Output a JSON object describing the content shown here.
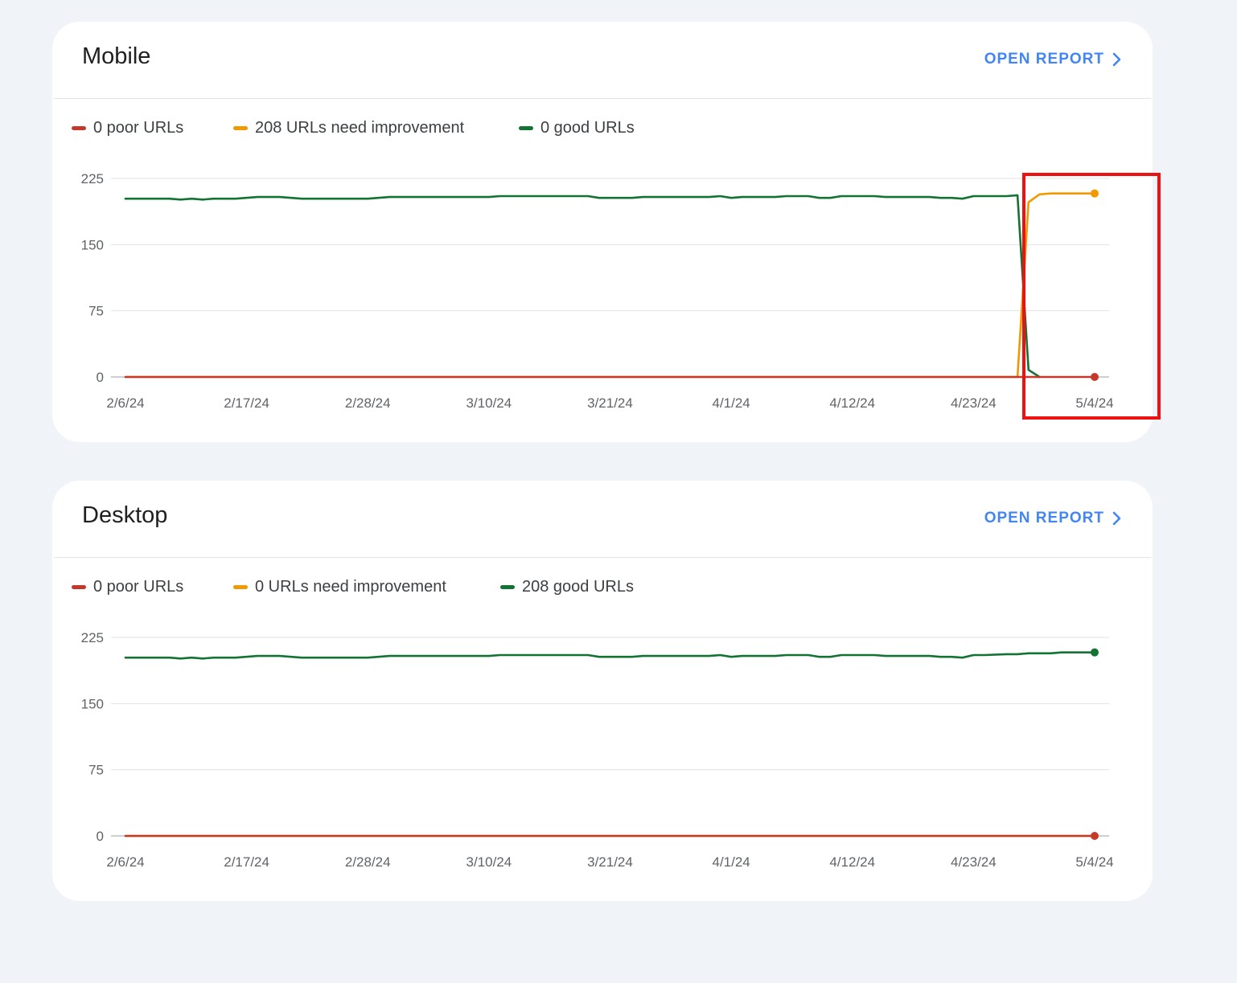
{
  "colors": {
    "poor": "#c5392a",
    "needs_improvement": "#f29900",
    "good": "#137333",
    "accent": "#4285f4",
    "highlight": "#ee1111"
  },
  "cards": [
    {
      "title": "Mobile",
      "open_report_label": "OPEN REPORT",
      "legend": [
        {
          "label": "0 poor URLs"
        },
        {
          "label": "208 URLs need improvement"
        },
        {
          "label": "0 good URLs"
        }
      ]
    },
    {
      "title": "Desktop",
      "open_report_label": "OPEN REPORT",
      "legend": [
        {
          "label": "0 poor URLs"
        },
        {
          "label": "0 URLs need improvement"
        },
        {
          "label": "208 good URLs"
        }
      ]
    }
  ],
  "chart_data": [
    {
      "type": "line",
      "ylim": [
        0,
        225
      ],
      "y_ticks": [
        0,
        75,
        150,
        225
      ],
      "x_ticks": [
        "2/6/24",
        "2/17/24",
        "2/28/24",
        "3/10/24",
        "3/21/24",
        "4/1/24",
        "4/12/24",
        "4/23/24",
        "5/4/24"
      ],
      "x_start": "2024-02-06",
      "x_end": "2024-05-04",
      "grid": true,
      "series": [
        {
          "name": "0 poor URLs",
          "color_key": "poor",
          "end_marker": true,
          "points": [
            [
              "2024-02-06",
              0
            ],
            [
              "2024-05-04",
              0
            ]
          ]
        },
        {
          "name": "208 URLs need improvement",
          "color_key": "needs_improvement",
          "end_marker": true,
          "points": [
            [
              "2024-02-06",
              0
            ],
            [
              "2024-04-27",
              0
            ],
            [
              "2024-04-28",
              198
            ],
            [
              "2024-04-29",
              207
            ],
            [
              "2024-04-30",
              208
            ],
            [
              "2024-05-04",
              208
            ]
          ]
        },
        {
          "name": "0 good URLs",
          "color_key": "good",
          "end_marker": false,
          "points": [
            [
              "2024-02-06",
              202
            ],
            [
              "2024-02-10",
              202
            ],
            [
              "2024-02-11",
              201
            ],
            [
              "2024-02-12",
              202
            ],
            [
              "2024-02-13",
              201
            ],
            [
              "2024-02-14",
              202
            ],
            [
              "2024-02-16",
              202
            ],
            [
              "2024-02-18",
              204
            ],
            [
              "2024-02-20",
              204
            ],
            [
              "2024-02-22",
              202
            ],
            [
              "2024-02-28",
              202
            ],
            [
              "2024-03-01",
              204
            ],
            [
              "2024-03-10",
              204
            ],
            [
              "2024-03-11",
              205
            ],
            [
              "2024-03-19",
              205
            ],
            [
              "2024-03-20",
              203
            ],
            [
              "2024-03-23",
              203
            ],
            [
              "2024-03-24",
              204
            ],
            [
              "2024-03-30",
              204
            ],
            [
              "2024-03-31",
              205
            ],
            [
              "2024-04-01",
              203
            ],
            [
              "2024-04-02",
              204
            ],
            [
              "2024-04-05",
              204
            ],
            [
              "2024-04-06",
              205
            ],
            [
              "2024-04-08",
              205
            ],
            [
              "2024-04-09",
              203
            ],
            [
              "2024-04-10",
              203
            ],
            [
              "2024-04-11",
              205
            ],
            [
              "2024-04-14",
              205
            ],
            [
              "2024-04-15",
              204
            ],
            [
              "2024-04-19",
              204
            ],
            [
              "2024-04-20",
              203
            ],
            [
              "2024-04-21",
              203
            ],
            [
              "2024-04-22",
              202
            ],
            [
              "2024-04-23",
              205
            ],
            [
              "2024-04-24",
              205
            ],
            [
              "2024-04-26",
              205
            ],
            [
              "2024-04-27",
              206
            ],
            [
              "2024-04-28",
              8
            ],
            [
              "2024-04-29",
              0
            ]
          ]
        }
      ]
    },
    {
      "type": "line",
      "ylim": [
        0,
        225
      ],
      "y_ticks": [
        0,
        75,
        150,
        225
      ],
      "x_ticks": [
        "2/6/24",
        "2/17/24",
        "2/28/24",
        "3/10/24",
        "3/21/24",
        "4/1/24",
        "4/12/24",
        "4/23/24",
        "5/4/24"
      ],
      "x_start": "2024-02-06",
      "x_end": "2024-05-04",
      "grid": true,
      "series": [
        {
          "name": "0 poor URLs",
          "color_key": "poor",
          "end_marker": true,
          "points": [
            [
              "2024-02-06",
              0
            ],
            [
              "2024-05-04",
              0
            ]
          ]
        },
        {
          "name": "0 URLs need improvement",
          "color_key": "needs_improvement",
          "end_marker": false,
          "points": [
            [
              "2024-02-06",
              0
            ],
            [
              "2024-05-04",
              0
            ]
          ]
        },
        {
          "name": "208 good URLs",
          "color_key": "good",
          "end_marker": true,
          "points": [
            [
              "2024-02-06",
              202
            ],
            [
              "2024-02-10",
              202
            ],
            [
              "2024-02-11",
              201
            ],
            [
              "2024-02-12",
              202
            ],
            [
              "2024-02-13",
              201
            ],
            [
              "2024-02-14",
              202
            ],
            [
              "2024-02-16",
              202
            ],
            [
              "2024-02-18",
              204
            ],
            [
              "2024-02-20",
              204
            ],
            [
              "2024-02-22",
              202
            ],
            [
              "2024-02-28",
              202
            ],
            [
              "2024-03-01",
              204
            ],
            [
              "2024-03-10",
              204
            ],
            [
              "2024-03-11",
              205
            ],
            [
              "2024-03-19",
              205
            ],
            [
              "2024-03-20",
              203
            ],
            [
              "2024-03-23",
              203
            ],
            [
              "2024-03-24",
              204
            ],
            [
              "2024-03-30",
              204
            ],
            [
              "2024-03-31",
              205
            ],
            [
              "2024-04-01",
              203
            ],
            [
              "2024-04-02",
              204
            ],
            [
              "2024-04-05",
              204
            ],
            [
              "2024-04-06",
              205
            ],
            [
              "2024-04-08",
              205
            ],
            [
              "2024-04-09",
              203
            ],
            [
              "2024-04-10",
              203
            ],
            [
              "2024-04-11",
              205
            ],
            [
              "2024-04-14",
              205
            ],
            [
              "2024-04-15",
              204
            ],
            [
              "2024-04-19",
              204
            ],
            [
              "2024-04-20",
              203
            ],
            [
              "2024-04-21",
              203
            ],
            [
              "2024-04-22",
              202
            ],
            [
              "2024-04-23",
              205
            ],
            [
              "2024-04-24",
              205
            ],
            [
              "2024-04-26",
              206
            ],
            [
              "2024-04-27",
              206
            ],
            [
              "2024-04-28",
              207
            ],
            [
              "2024-04-30",
              207
            ],
            [
              "2024-05-01",
              208
            ],
            [
              "2024-05-04",
              208
            ]
          ]
        }
      ]
    }
  ]
}
